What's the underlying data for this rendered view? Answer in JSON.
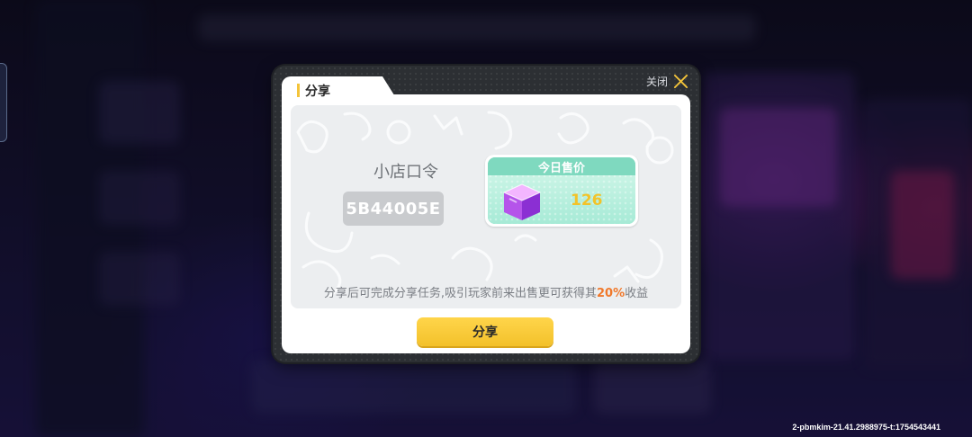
{
  "dialog": {
    "title": "分享",
    "close_label": "关闭",
    "shop_code_title": "小店口令",
    "shop_code": "5B44005E",
    "price_card": {
      "header": "今日售价",
      "value": "126",
      "icon": "purple-cube-icon"
    },
    "hint": {
      "before": "分享后可完成分享任务,吸引玩家前来出售更可获得其",
      "percent": "20%",
      "after": "收益"
    },
    "share_button": "分享"
  },
  "watermark": "2-pbmkim-21.41.2988975-t:1754543441",
  "colors": {
    "accent_yellow": "#f4c43a",
    "button_yellow": "#f3c12b",
    "mint": "#7fd9bf",
    "orange": "#f0782a",
    "dialog_frame": "#2c2f33"
  }
}
